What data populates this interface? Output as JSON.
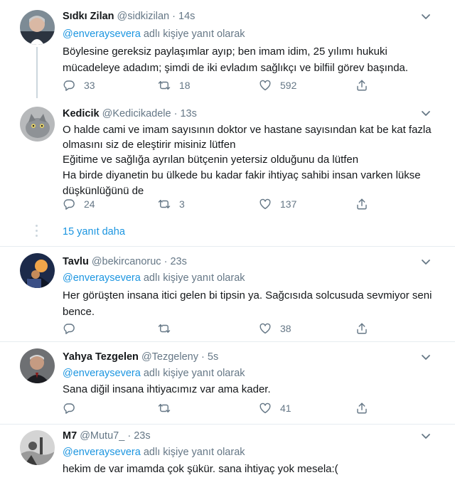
{
  "replying_suffix": " adlı kişiye yanıt olarak",
  "tweets": [
    {
      "name": "Sıdkı Zilan",
      "handle": "@sidkizilan",
      "time": "14s",
      "reply_to": "@enveraysevera",
      "lines": [
        "Böylesine gereksiz paylaşımlar ayıp; ben imam idim, 25 yılımı hukuki",
        "mücadeleye adadım; şimdi de iki evladım sağlıkçı ve bilfiil görev başında."
      ],
      "replies": "33",
      "retweets": "18",
      "likes": "592"
    },
    {
      "name": "Kedicik",
      "handle": "@Kedicikadele",
      "time": "13s",
      "reply_to": "",
      "lines": [
        "O halde cami ve imam sayısının doktor ve hastane sayısından kat be kat fazla",
        "olmasını siz de eleştirir misiniz lütfen",
        "Eğitime ve sağlığa ayrılan bütçenin yetersiz olduğunu da lütfen",
        "Ha birde diyanetin bu ülkede bu kadar fakir ihtiyaç sahibi insan varken lükse",
        "düşkünlüğünü de"
      ],
      "replies": "24",
      "retweets": "3",
      "likes": "137"
    },
    {
      "name": "Tavlu",
      "handle": "@bekircanoruc",
      "time": "23s",
      "reply_to": "@enveraysevera",
      "lines": [
        "Her görüşten insana itici gelen bi tipsin ya. Sağcısıda solcusuda sevmiyor seni",
        "bence."
      ],
      "replies": "",
      "retweets": "",
      "likes": "38"
    },
    {
      "name": "Yahya Tezgelen",
      "handle": "@Tezgeleny",
      "time": "5s",
      "reply_to": "@enveraysevera",
      "lines": [
        "Sana diğil insana ihtiyacımız var ama kader."
      ],
      "replies": "",
      "retweets": "",
      "likes": "41"
    },
    {
      "name": "M7",
      "handle": "@Mutu7_",
      "time": "23s",
      "reply_to": "@enveraysevera",
      "lines": [
        "hekim de var imamda çok şükür. sana ihtiyaç yok mesela:("
      ]
    }
  ],
  "more_replies": "15 yanıt daha",
  "icons": {
    "reply": "reply-icon",
    "retweet": "retweet-icon",
    "like": "heart-icon",
    "share": "share-icon",
    "caret": "chevron-down-icon"
  },
  "colors": {
    "link": "#1b95e0",
    "muted": "#657786",
    "divider": "#e6ecf0",
    "thread": "#ccd6dd"
  }
}
